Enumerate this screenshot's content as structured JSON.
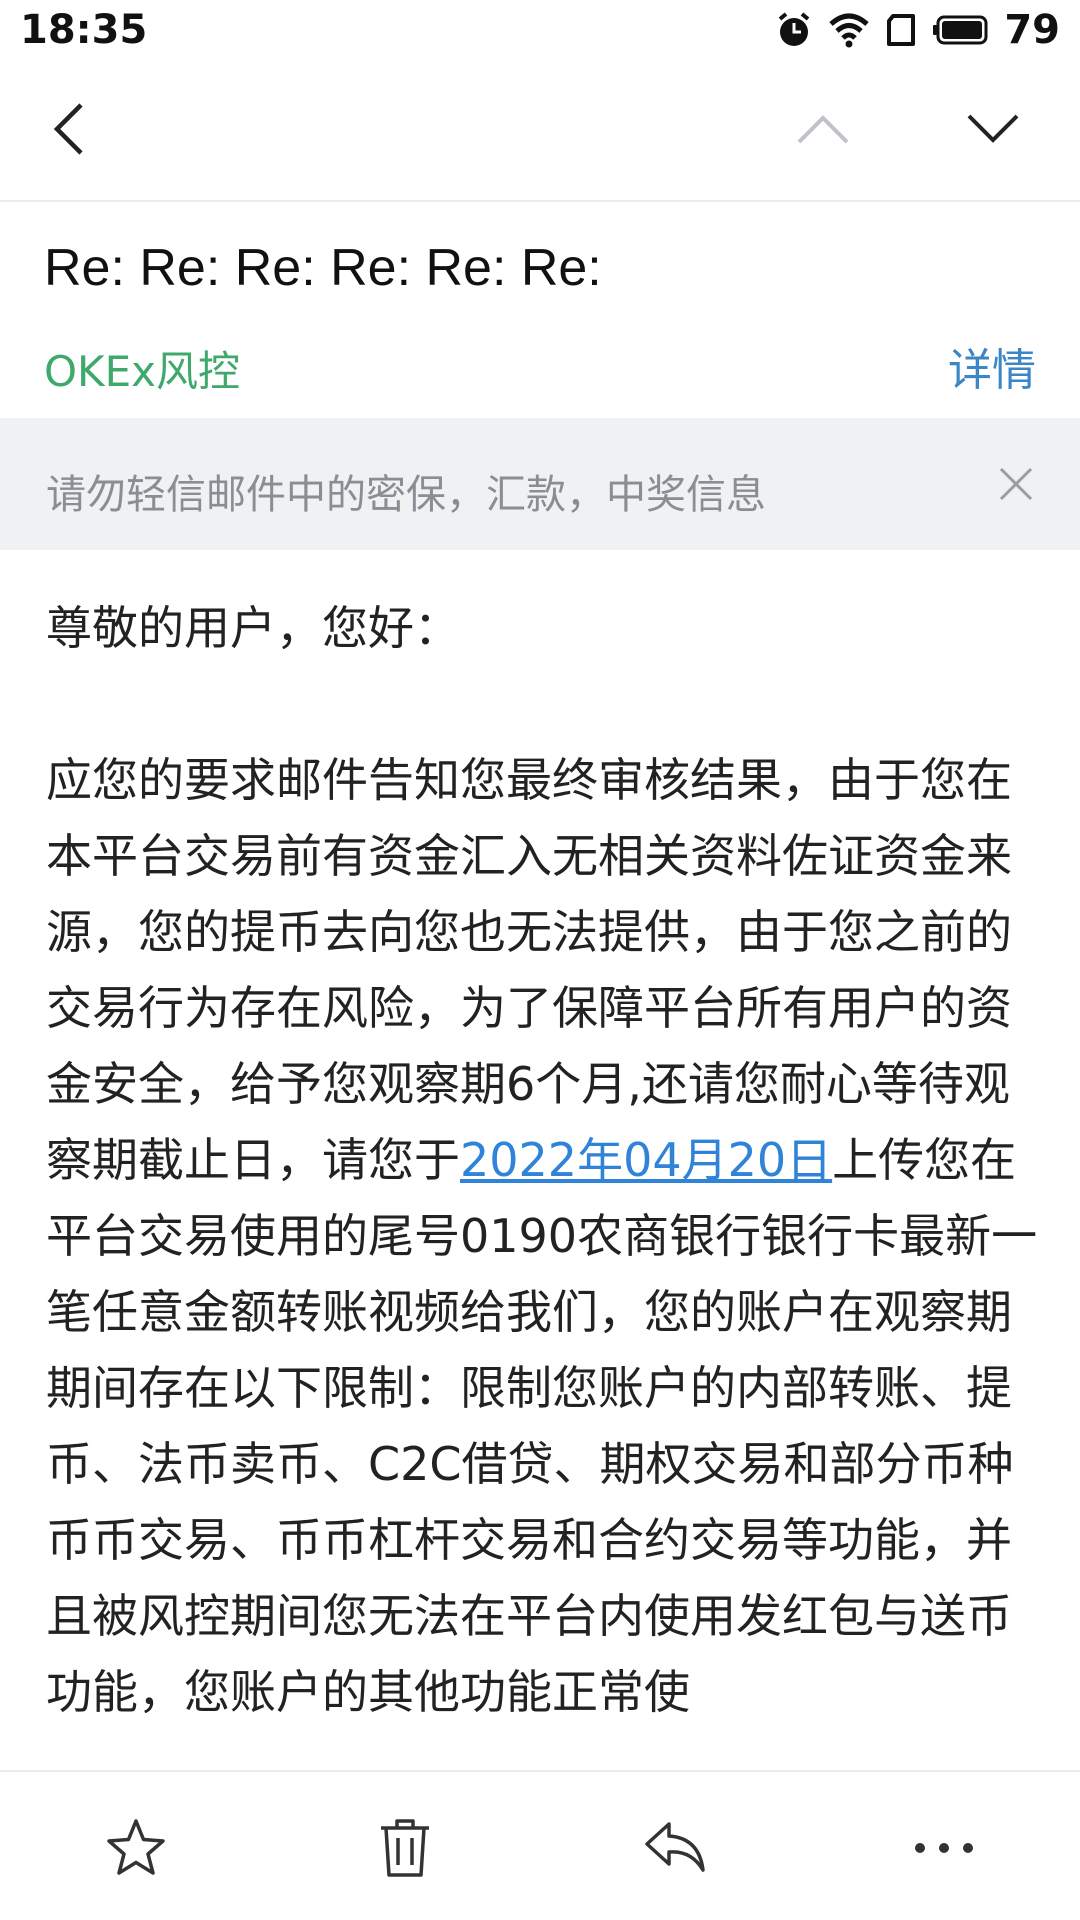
{
  "status_bar": {
    "time": "18:35",
    "battery_level": "79"
  },
  "nav": {
    "back_icon": "back-chevron-icon",
    "prev_icon": "chevron-up-icon",
    "next_icon": "chevron-down-icon"
  },
  "email": {
    "subject": "Re: Re: Re: Re: Re: Re:",
    "sender": "OKEx风控",
    "details_label": "详情",
    "warning": "请勿轻信邮件中的密保，汇款，中奖信息",
    "greeting": "尊敬的用户，您好：",
    "body_part1": "应您的要求邮件告知您最终审核结果，由于您在本平台交易前有资金汇入无相关资料佐证资金来源，您的提币去向您也无法提供，由于您之前的交易行为存在风险，为了保障平台所有用户的资金安全，给予您观察期6个月,还请您耐心等待观察期截止日，请您于",
    "date_link": "2022年04月20日",
    "body_part2": "上传您在平台交易使用的尾号0190农商银行银行卡最新一笔任意金额转账视频给我们，您的账户在观察期期间存在以下限制：限制您账户的内部转账、提币、法币卖币、C2C借贷、期权交易和部分币种币币交易、币币杠杆交易和合约交易等功能，并且被风控期间您无法在平台内使用发红包与送币功能，您账户的其他功能正常使"
  },
  "colors": {
    "sender": "#3fa86b",
    "link": "#2f83d8",
    "details": "#3b86c6",
    "banner_bg": "#f0f1f3"
  }
}
